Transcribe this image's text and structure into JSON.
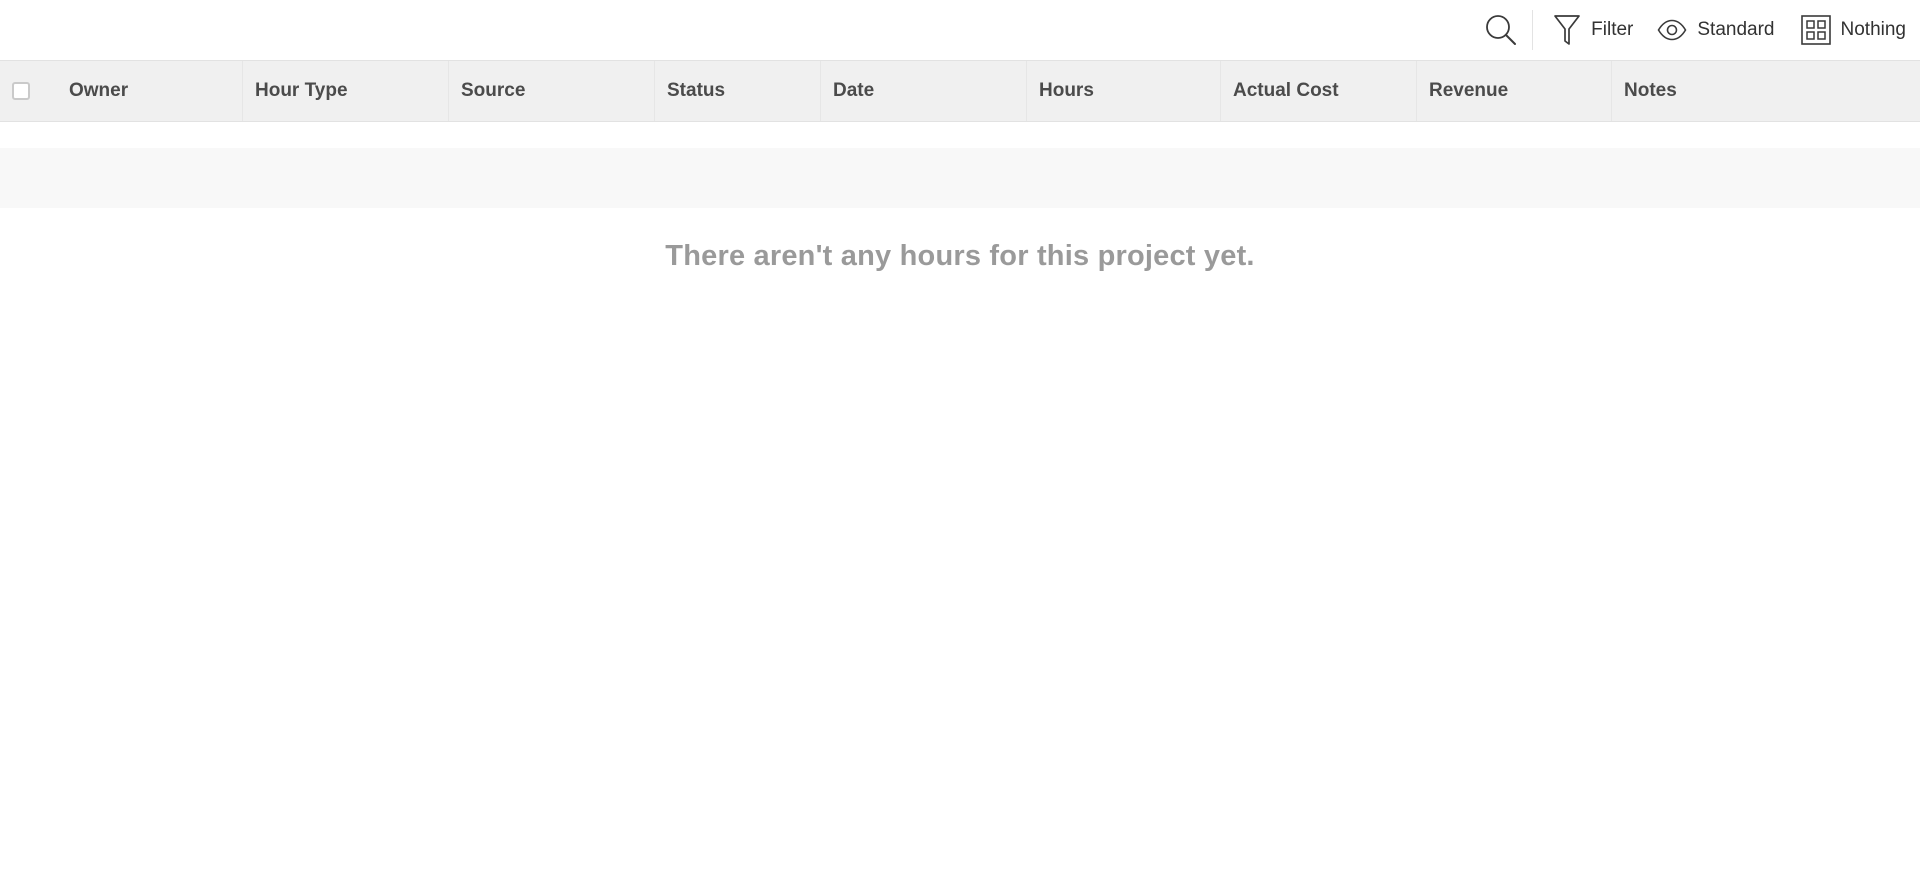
{
  "toolbar": {
    "search_icon": "search-icon",
    "filter_label": "Filter",
    "filter_icon": "funnel-icon",
    "view_label": "Standard",
    "view_icon": "eye-icon",
    "group_label": "Nothing",
    "group_icon": "grid-icon"
  },
  "table": {
    "columns": [
      "Owner",
      "Hour Type",
      "Source",
      "Status",
      "Date",
      "Hours",
      "Actual Cost",
      "Revenue",
      "Notes"
    ],
    "select_all_checked": false
  },
  "empty_state": {
    "message": "There aren't any hours for this project yet."
  },
  "colors": {
    "header_bg": "#f0f0f0",
    "empty_text": "#9a9a9a",
    "band_bg": "#f8f8f8"
  }
}
